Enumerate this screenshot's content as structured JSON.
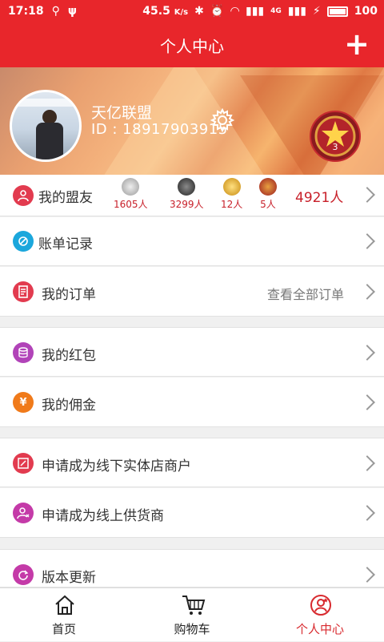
{
  "status_bar": {
    "time": "17:18",
    "speed": "45.5",
    "speed_unit": "K/s",
    "network": "4G",
    "battery": "100"
  },
  "header": {
    "title": "个人中心",
    "add_icon": "plus-icon"
  },
  "profile": {
    "name": "天亿联盟",
    "id_label": "ID : 18917903915",
    "settings_icon": "gear-icon",
    "level_badge": "3"
  },
  "friends": {
    "label": "我的盟友",
    "stats": [
      {
        "count": "1605人",
        "color": "#b9b9b9"
      },
      {
        "count": "3299人",
        "color": "#4a4a4a"
      },
      {
        "count": "12人",
        "color": "#d99a1a"
      },
      {
        "count": "5人",
        "color": "#b8232a"
      }
    ],
    "total": "4921人"
  },
  "menu": {
    "bill": "账单记录",
    "orders": "我的订单",
    "orders_extra": "查看全部订单",
    "red_packet": "我的红包",
    "commission": "我的佣金",
    "offline_merchant": "申请成为线下实体店商户",
    "online_supplier": "申请成为线上供货商",
    "version_update": "版本更新"
  },
  "tabbar": {
    "home": "首页",
    "cart": "购物车",
    "profile": "个人中心"
  },
  "colors": {
    "accent": "#e8262b",
    "active_tab": "#d82a2f"
  }
}
